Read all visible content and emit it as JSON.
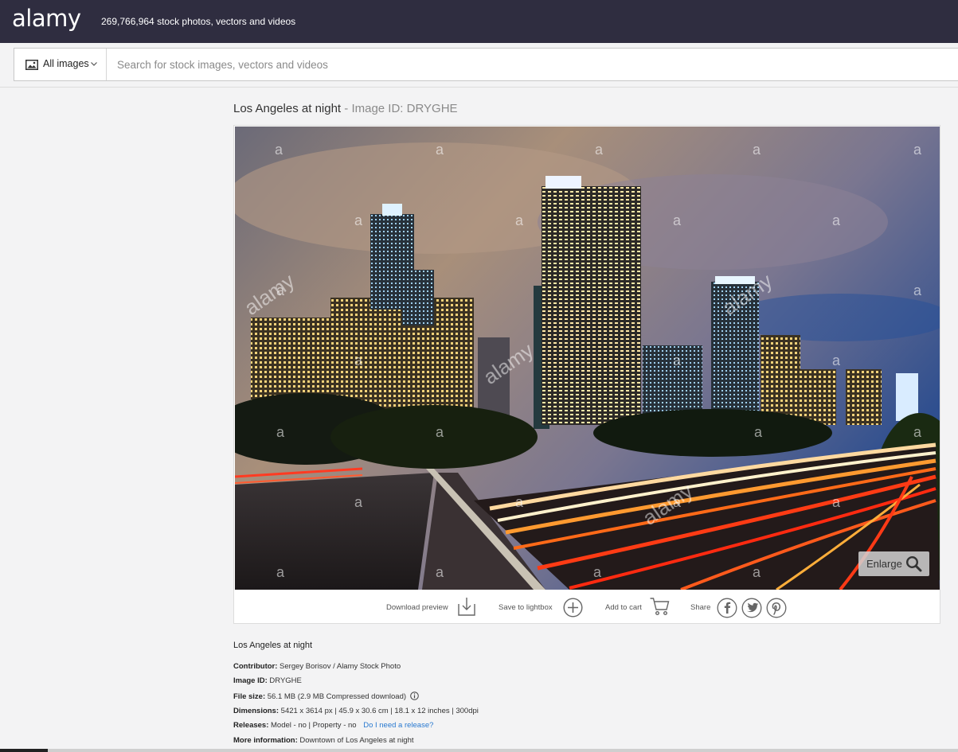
{
  "header": {
    "logo": "alamy",
    "tagline": "269,766,964 stock photos, vectors and videos"
  },
  "search": {
    "category": "All images",
    "placeholder": "Search for stock images, vectors and videos"
  },
  "image": {
    "title": "Los Angeles at night",
    "separator": " - ",
    "id_label": "Image ID: DRYGHE",
    "watermark": "alamy",
    "enlarge_label": "Enlarge"
  },
  "actions": {
    "download": "Download preview",
    "lightbox": "Save to lightbox",
    "cart": "Add to cart",
    "share": "Share"
  },
  "details": {
    "description": "Los Angeles at night",
    "contributor_label": "Contributor:",
    "contributor": "Sergey Borisov / Alamy Stock Photo",
    "image_id_label": "Image ID:",
    "image_id": "DRYGHE",
    "file_size_label": "File size:",
    "file_size": "56.1 MB (2.9 MB Compressed download)",
    "dimensions_label": "Dimensions:",
    "dimensions": "5421 x 3614 px | 45.9 x 30.6 cm | 18.1 x 12 inches | 300dpi",
    "releases_label": "Releases:",
    "releases": "Model - no | Property - no",
    "release_link": "Do I need a release?",
    "more_info_label": "More information:",
    "more_info": "Downtown of Los Angeles at night"
  },
  "icons": {
    "image": "image-icon",
    "chevron": "chevron-down-icon",
    "zoom": "magnifier-icon",
    "download": "download-icon",
    "lightbox": "plus-circle-icon",
    "cart": "cart-icon",
    "facebook": "facebook-icon",
    "twitter": "twitter-icon",
    "pinterest": "pinterest-icon",
    "info": "info-icon"
  },
  "colors": {
    "header_bg": "#2f2d40",
    "link": "#2a7ad0"
  }
}
